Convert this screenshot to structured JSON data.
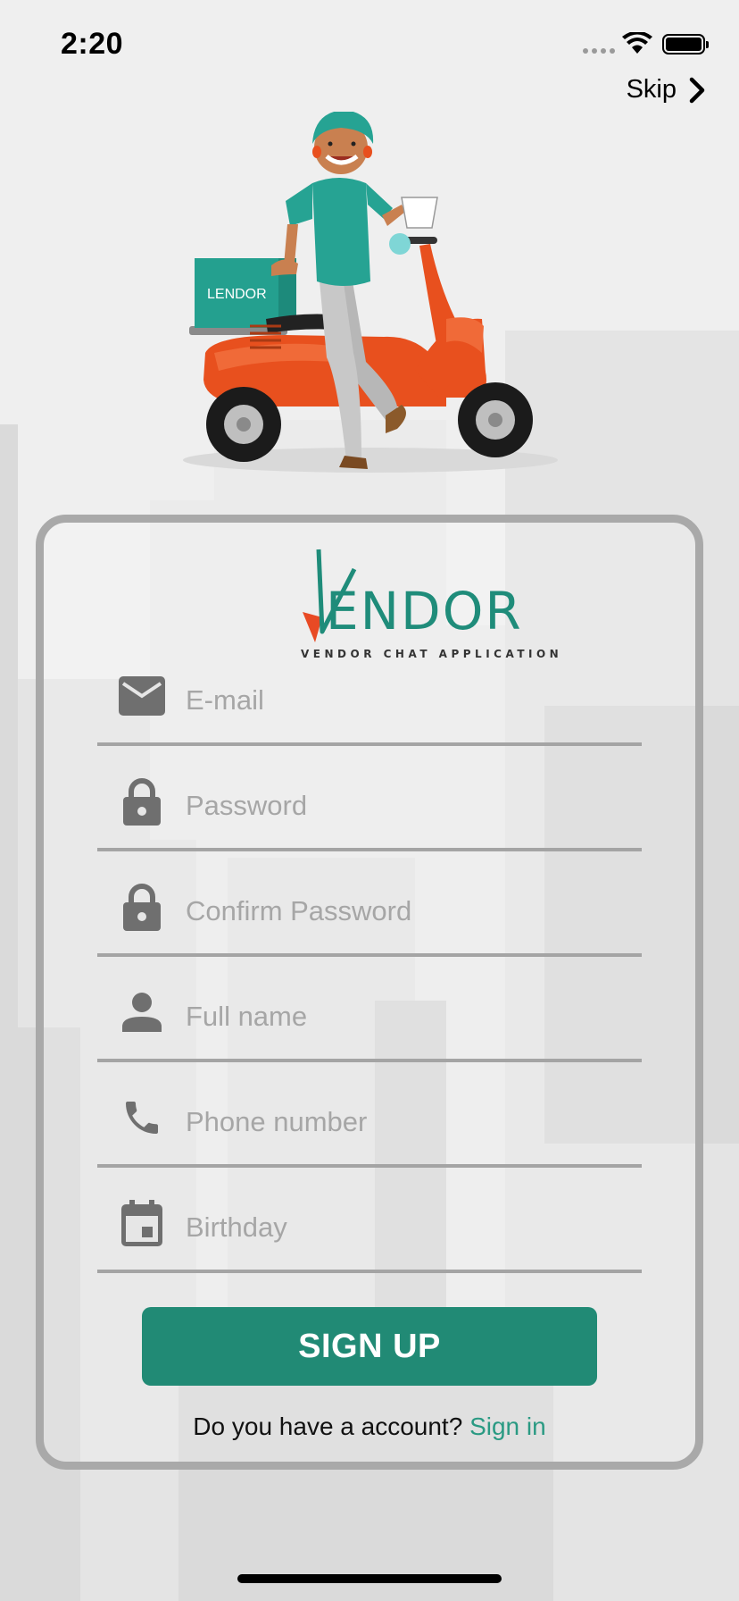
{
  "status_bar": {
    "time": "2:20"
  },
  "header": {
    "skip_label": "Skip"
  },
  "hero": {
    "box_label": "LENDOR"
  },
  "logo": {
    "wordmark": "ENDOR",
    "tagline": "VENDOR CHAT APPLICATION"
  },
  "form": {
    "fields": [
      {
        "placeholder": "E-mail",
        "value": "",
        "icon": "mail-icon"
      },
      {
        "placeholder": "Password",
        "value": "",
        "icon": "lock-icon"
      },
      {
        "placeholder": "Confirm Password",
        "value": "",
        "icon": "lock-icon"
      },
      {
        "placeholder": "Full name",
        "value": "",
        "icon": "person-icon"
      },
      {
        "placeholder": "Phone number",
        "value": "",
        "icon": "phone-icon"
      },
      {
        "placeholder": "Birthday",
        "value": "",
        "icon": "calendar-icon"
      }
    ],
    "submit_label": "SIGN UP",
    "account_prompt": "Do you have a account?",
    "signin_label": "Sign in"
  },
  "colors": {
    "accent": "#218a75",
    "link": "#2a9a83",
    "scooter": "#e8501e",
    "shirt": "#26a393"
  }
}
